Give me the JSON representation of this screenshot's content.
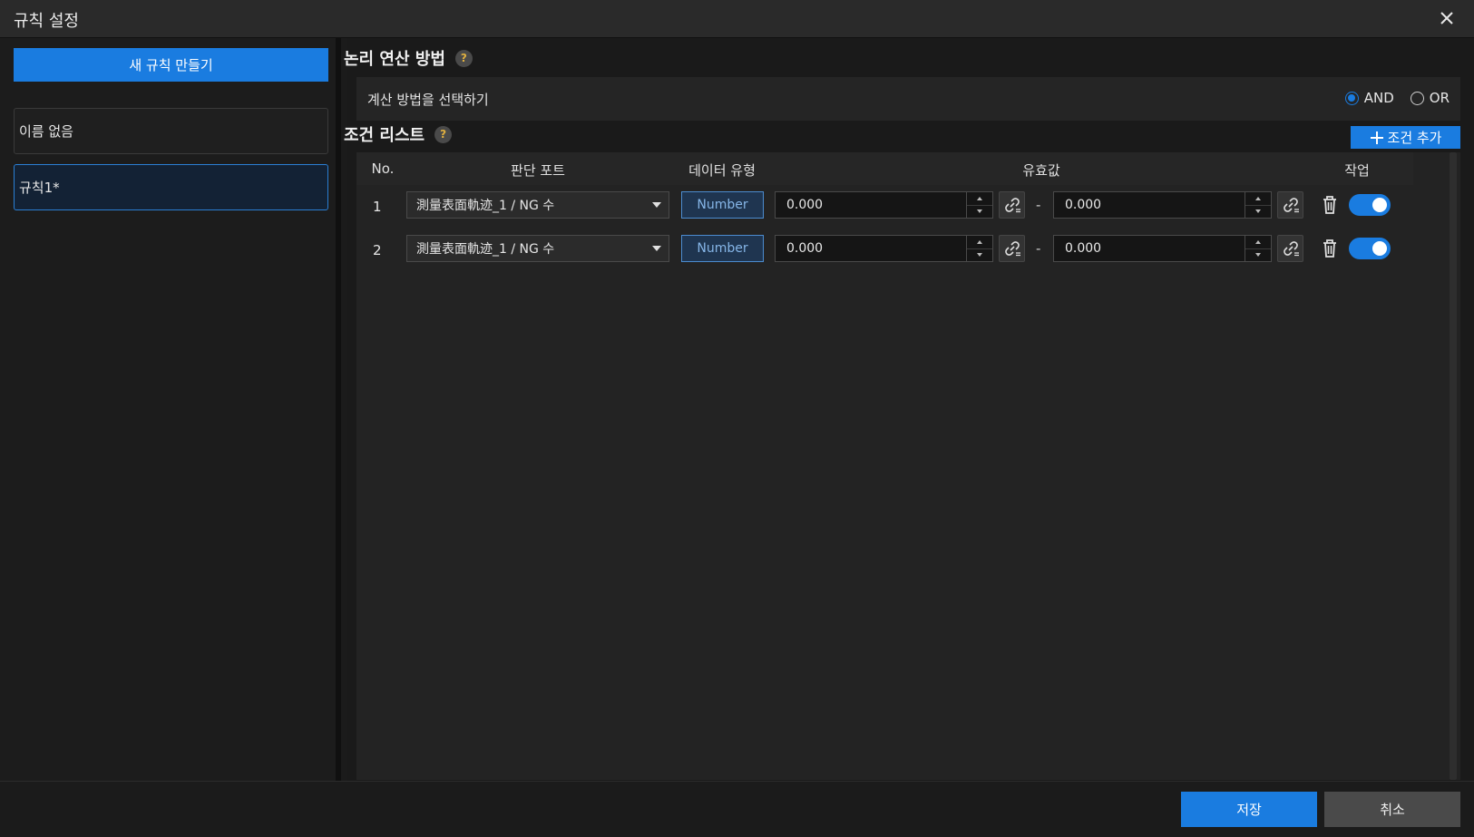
{
  "dialog": {
    "title": "규칙 설정"
  },
  "sidebar": {
    "new_rule_label": "새 규칙 만들기",
    "rules": [
      {
        "label": "이름 없음",
        "selected": false
      },
      {
        "label": "규칙1*",
        "selected": true
      }
    ]
  },
  "logic": {
    "title": "논리 연산 방법",
    "help": "?",
    "calc_label": "계산 방법을 선택하기",
    "options": [
      {
        "label": "AND",
        "checked": true
      },
      {
        "label": "OR",
        "checked": false
      }
    ]
  },
  "conditions": {
    "title": "조건 리스트",
    "help": "?",
    "add_label": "조건 추가",
    "headers": {
      "no": "No.",
      "port": "판단 포트",
      "type": "데이터 유형",
      "valid": "유효값",
      "action": "작업"
    },
    "rows": [
      {
        "no": "1",
        "port": "測量表面軌迹_1 / NG 수",
        "type": "Number",
        "min": "0.000",
        "max": "0.000",
        "enabled": true
      },
      {
        "no": "2",
        "port": "測量表面軌迹_1 / NG 수",
        "type": "Number",
        "min": "0.000",
        "max": "0.000",
        "enabled": true
      }
    ],
    "range_separator": "-"
  },
  "footer": {
    "save_label": "저장",
    "cancel_label": "취소"
  },
  "colors": {
    "accent": "#1a7ce0",
    "panel": "#232323",
    "background": "#1b1b1b"
  }
}
